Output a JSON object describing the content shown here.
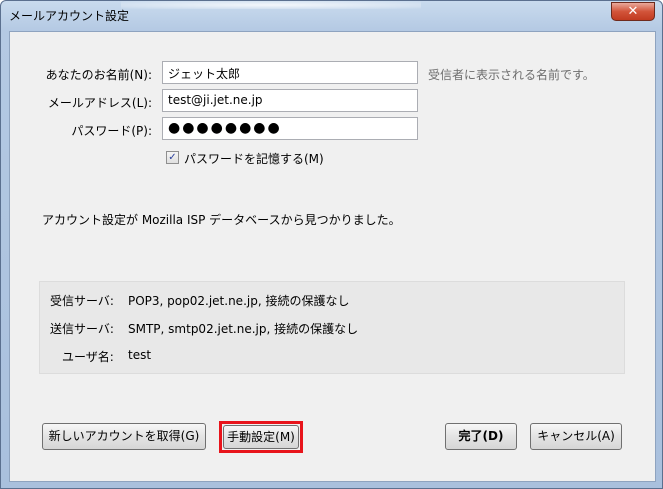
{
  "window": {
    "title": "メールアカウント設定",
    "close_label": "✕"
  },
  "form": {
    "name": {
      "label": "あなたのお名前(N):",
      "value": "ジェット太郎",
      "hint": "受信者に表示される名前です。"
    },
    "email": {
      "label": "メールアドレス(L):",
      "value": "test@ji.jet.ne.jp"
    },
    "password": {
      "label": "パスワード(P):",
      "value": "●●●●●●●●"
    },
    "remember": {
      "label": "パスワードを記憶する(M)",
      "checked": true,
      "check_glyph": "✓"
    }
  },
  "message": "アカウント設定が Mozilla ISP データベースから見つかりました。",
  "info": {
    "incoming": {
      "label": "受信サーバ:",
      "value": "POP3, pop02.jet.ne.jp, 接続の保護なし"
    },
    "outgoing": {
      "label": "送信サーバ:",
      "value": "SMTP, smtp02.jet.ne.jp, 接続の保護なし"
    },
    "username": {
      "label": "ユーザ名:",
      "value": "test"
    }
  },
  "buttons": {
    "new_account": "新しいアカウントを取得(G)",
    "manual": "手動設定(M)",
    "done": "完了(D)",
    "cancel": "キャンセル(A)"
  },
  "colors": {
    "highlight": "#e8141b"
  }
}
